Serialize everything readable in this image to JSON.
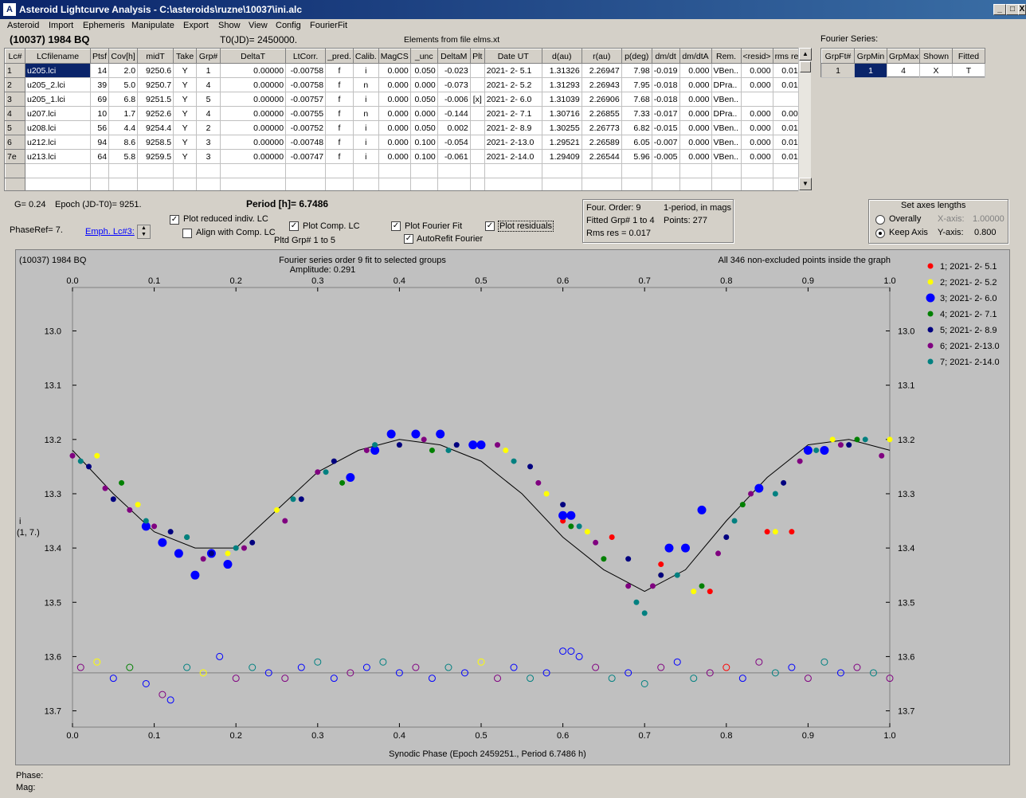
{
  "window": {
    "title": "Asteroid Lightcurve Analysis - C:\\asteroids\\ruzne\\10037\\ini.alc",
    "icon": "app-icon",
    "controls": [
      "_",
      "□",
      "X"
    ]
  },
  "menu": [
    "Asteroid",
    "Import",
    "Ephemeris",
    "Manipulate",
    "Export",
    "Show",
    "View",
    "Config",
    "FourierFit"
  ],
  "header": {
    "asteroid": "(10037) 1984 BQ",
    "t0": "T0(JD)= 2450000.",
    "elements": "Elements from file elms.xt",
    "fourier_series_label": "Fourier Series:"
  },
  "lc_table": {
    "columns": [
      "Lc#",
      "LCfilename",
      "Ptsf",
      "Cov[h]",
      "midT",
      "Take",
      "Grp#",
      "DeltaT",
      "LtCorr.",
      "_pred.",
      "Calib.",
      "MagCS",
      "_unc",
      "DeltaM",
      "Plt",
      "Date UT",
      "d(au)",
      "r(au)",
      "p(deg)",
      "dm/dt",
      "dm/dtA",
      "Rem.",
      "<resid>",
      "rms res"
    ],
    "rows": [
      [
        "1",
        "u205.lci",
        "14",
        "2.0",
        "9250.6",
        "Y",
        "1",
        "0.00000",
        "-0.00758",
        "f",
        "i",
        "0.000",
        "0.050",
        "-0.023",
        "",
        "2021- 2- 5.1",
        "1.31326",
        "2.26947",
        "7.98",
        "-0.019",
        "0.000",
        "VBen..",
        "0.000",
        "0.013"
      ],
      [
        "2",
        "u205_2.lci",
        "39",
        "5.0",
        "9250.7",
        "Y",
        "4",
        "0.00000",
        "-0.00758",
        "f",
        "n",
        "0.000",
        "0.000",
        "-0.073",
        "",
        "2021- 2- 5.2",
        "1.31293",
        "2.26943",
        "7.95",
        "-0.018",
        "0.000",
        "DPra..",
        "0.000",
        "0.015"
      ],
      [
        "3",
        "u205_1.lci",
        "69",
        "6.8",
        "9251.5",
        "Y",
        "5",
        "0.00000",
        "-0.00757",
        "f",
        "i",
        "0.000",
        "0.050",
        "-0.006",
        "[x]",
        "2021- 2- 6.0",
        "1.31039",
        "2.26906",
        "7.68",
        "-0.018",
        "0.000",
        "VBen..",
        "",
        ""
      ],
      [
        "4",
        "u207.lci",
        "10",
        "1.7",
        "9252.6",
        "Y",
        "4",
        "0.00000",
        "-0.00755",
        "f",
        "n",
        "0.000",
        "0.000",
        "-0.144",
        "",
        "2021- 2- 7.1",
        "1.30716",
        "2.26855",
        "7.33",
        "-0.017",
        "0.000",
        "DPra..",
        "0.000",
        "0.009"
      ],
      [
        "5",
        "u208.lci",
        "56",
        "4.4",
        "9254.4",
        "Y",
        "2",
        "0.00000",
        "-0.00752",
        "f",
        "i",
        "0.000",
        "0.050",
        "0.002",
        "",
        "2021- 2- 8.9",
        "1.30255",
        "2.26773",
        "6.82",
        "-0.015",
        "0.000",
        "VBen..",
        "0.000",
        "0.013"
      ],
      [
        "6",
        "u212.lci",
        "94",
        "8.6",
        "9258.5",
        "Y",
        "3",
        "0.00000",
        "-0.00748",
        "f",
        "i",
        "0.000",
        "0.100",
        "-0.054",
        "",
        "2021- 2-13.0",
        "1.29521",
        "2.26589",
        "6.05",
        "-0.007",
        "0.000",
        "VBen..",
        "0.000",
        "0.018"
      ],
      [
        "7e",
        "u213.lci",
        "64",
        "5.8",
        "9259.5",
        "Y",
        "3",
        "0.00000",
        "-0.00747",
        "f",
        "i",
        "0.000",
        "0.100",
        "-0.061",
        "",
        "2021- 2-14.0",
        "1.29409",
        "2.26544",
        "5.96",
        "-0.005",
        "0.000",
        "VBen..",
        "0.000",
        "0.018"
      ]
    ],
    "empty_rows": 2
  },
  "fourier_table": {
    "columns": [
      "GrpFt#",
      "GrpMin",
      "GrpMax",
      "Shown",
      "Fitted"
    ],
    "row": [
      "1",
      "1",
      "4",
      "X",
      "T"
    ]
  },
  "controls": {
    "g": "G= 0.24",
    "epoch": "Epoch (JD-T0)= 9251.",
    "period": "Period [h]= 6.7486",
    "phaseref": "PhaseRef= 7.",
    "emph": "Emph. Lc#3:",
    "plot_reduced": "Plot reduced indiv. LC",
    "align": "Align with Comp. LC",
    "plot_comp": "Plot Comp. LC",
    "pltd_grp": "Pltd Grp#  1   to   5",
    "plot_fourier": "Plot Fourier Fit",
    "autorefit": "AutoRefit Fourier",
    "plot_resid": "Plot residuals",
    "four_order": "Four. Order:  9",
    "one_period": "1-period, in mags",
    "fitted_grp": "Fitted Grp# 1 to 4",
    "points": "Points: 277",
    "rms_res": "Rms res      = 0.017",
    "axes_title": "Set axes lengths",
    "overally": "Overally",
    "keep_axis": "Keep Axis",
    "x_axis_label": "X-axis:",
    "x_axis_val": "1.00000",
    "y_axis_label": "Y-axis:",
    "y_axis_val": "0.800",
    "checks": {
      "plot_reduced": true,
      "align": false,
      "plot_comp": true,
      "plot_fourier": true,
      "autorefit": true,
      "plot_resid": true
    }
  },
  "plot": {
    "top_left": "(10037) 1984 BQ",
    "title1": "Fourier series order 9 fit to selected groups",
    "title2": "Amplitude: 0.291",
    "top_right": "All 346 non-excluded points inside the graph",
    "xlabel": "Synodic Phase (Epoch 2459251., Period 6.7486 h)",
    "ylabel1": "i",
    "ylabel2": "(1, 7.)",
    "phase_label": "Phase:",
    "mag_label": "Mag:"
  },
  "chart_data": {
    "type": "scatter",
    "xlim": [
      0.0,
      1.0
    ],
    "ylim": [
      13.73,
      12.92
    ],
    "y_inverted": true,
    "xticks": [
      0.0,
      0.1,
      0.2,
      0.3,
      0.4,
      0.5,
      0.6,
      0.7,
      0.8,
      0.9,
      1.0
    ],
    "yticks": [
      13.0,
      13.1,
      13.2,
      13.3,
      13.4,
      13.5,
      13.6,
      13.7
    ],
    "grid": false,
    "legend_position": "right",
    "fourier_curve": {
      "x": [
        0.0,
        0.05,
        0.1,
        0.15,
        0.2,
        0.25,
        0.3,
        0.35,
        0.4,
        0.45,
        0.5,
        0.55,
        0.6,
        0.65,
        0.7,
        0.75,
        0.8,
        0.85,
        0.9,
        0.95,
        1.0
      ],
      "y": [
        13.22,
        13.3,
        13.37,
        13.4,
        13.4,
        13.33,
        13.26,
        13.22,
        13.2,
        13.21,
        13.24,
        13.3,
        13.38,
        13.44,
        13.48,
        13.44,
        13.35,
        13.27,
        13.21,
        13.2,
        13.22
      ]
    },
    "residual_baseline": 13.63,
    "series": [
      {
        "name": "1; 2021- 2- 5.1",
        "color": "#ff0000",
        "size": "small",
        "x": [
          0.6,
          0.66,
          0.72,
          0.78,
          0.85,
          0.88
        ],
        "y": [
          13.35,
          13.38,
          13.43,
          13.48,
          13.37,
          13.37
        ]
      },
      {
        "name": "2; 2021- 2- 5.2",
        "color": "#ffff00",
        "size": "small",
        "x": [
          0.03,
          0.08,
          0.19,
          0.25,
          0.53,
          0.58,
          0.63,
          0.72,
          0.76,
          0.86,
          0.93,
          1.0
        ],
        "y": [
          13.23,
          13.32,
          13.41,
          13.33,
          13.22,
          13.3,
          13.37,
          13.45,
          13.48,
          13.37,
          13.2,
          13.2
        ]
      },
      {
        "name": "3; 2021- 2- 6.0",
        "color": "#0000ff",
        "size": "large",
        "x": [
          0.09,
          0.11,
          0.13,
          0.15,
          0.17,
          0.19,
          0.34,
          0.37,
          0.39,
          0.42,
          0.45,
          0.49,
          0.5,
          0.6,
          0.61,
          0.73,
          0.75,
          0.77,
          0.84,
          0.9,
          0.92
        ],
        "y": [
          13.36,
          13.39,
          13.41,
          13.45,
          13.41,
          13.43,
          13.27,
          13.22,
          13.19,
          13.19,
          13.19,
          13.21,
          13.21,
          13.34,
          13.34,
          13.4,
          13.4,
          13.33,
          13.29,
          13.22,
          13.22
        ]
      },
      {
        "name": "4; 2021- 2- 7.1",
        "color": "#008000",
        "size": "small",
        "x": [
          0.06,
          0.14,
          0.33,
          0.44,
          0.61,
          0.65,
          0.77,
          0.82,
          0.96
        ],
        "y": [
          13.28,
          13.38,
          13.28,
          13.22,
          13.36,
          13.42,
          13.47,
          13.32,
          13.2
        ]
      },
      {
        "name": "5; 2021- 2- 8.9",
        "color": "#000080",
        "size": "small",
        "x": [
          0.02,
          0.05,
          0.12,
          0.17,
          0.22,
          0.28,
          0.32,
          0.4,
          0.47,
          0.56,
          0.6,
          0.68,
          0.72,
          0.8,
          0.87,
          0.95
        ],
        "y": [
          13.25,
          13.31,
          13.37,
          13.41,
          13.39,
          13.31,
          13.24,
          13.21,
          13.21,
          13.25,
          13.32,
          13.42,
          13.45,
          13.38,
          13.28,
          13.21
        ]
      },
      {
        "name": "6; 2021- 2-13.0",
        "color": "#800080",
        "size": "small",
        "x": [
          0.0,
          0.04,
          0.07,
          0.1,
          0.16,
          0.21,
          0.26,
          0.3,
          0.36,
          0.43,
          0.52,
          0.57,
          0.64,
          0.68,
          0.71,
          0.79,
          0.83,
          0.89,
          0.94,
          0.99
        ],
        "y": [
          13.23,
          13.29,
          13.33,
          13.36,
          13.42,
          13.4,
          13.35,
          13.26,
          13.22,
          13.2,
          13.21,
          13.28,
          13.39,
          13.47,
          13.47,
          13.41,
          13.3,
          13.24,
          13.21,
          13.23
        ]
      },
      {
        "name": "7; 2021- 2-14.0",
        "color": "#008080",
        "size": "small",
        "x": [
          0.01,
          0.09,
          0.14,
          0.2,
          0.27,
          0.31,
          0.37,
          0.46,
          0.54,
          0.62,
          0.69,
          0.7,
          0.74,
          0.81,
          0.86,
          0.91,
          0.97
        ],
        "y": [
          13.24,
          13.35,
          13.38,
          13.4,
          13.31,
          13.26,
          13.21,
          13.22,
          13.24,
          13.36,
          13.5,
          13.52,
          13.45,
          13.35,
          13.3,
          13.22,
          13.2
        ]
      }
    ],
    "residuals": {
      "x": [
        0.01,
        0.03,
        0.05,
        0.07,
        0.09,
        0.11,
        0.12,
        0.14,
        0.16,
        0.18,
        0.2,
        0.22,
        0.24,
        0.26,
        0.28,
        0.3,
        0.32,
        0.34,
        0.36,
        0.38,
        0.4,
        0.42,
        0.44,
        0.46,
        0.48,
        0.5,
        0.52,
        0.54,
        0.56,
        0.58,
        0.6,
        0.61,
        0.62,
        0.64,
        0.66,
        0.68,
        0.7,
        0.72,
        0.74,
        0.76,
        0.78,
        0.8,
        0.82,
        0.84,
        0.86,
        0.88,
        0.9,
        0.92,
        0.94,
        0.96,
        0.98,
        1.0
      ],
      "y": [
        13.62,
        13.61,
        13.64,
        13.62,
        13.65,
        13.67,
        13.68,
        13.62,
        13.63,
        13.6,
        13.64,
        13.62,
        13.63,
        13.64,
        13.62,
        13.61,
        13.64,
        13.63,
        13.62,
        13.61,
        13.63,
        13.62,
        13.64,
        13.62,
        13.63,
        13.61,
        13.64,
        13.62,
        13.64,
        13.63,
        13.59,
        13.59,
        13.6,
        13.62,
        13.64,
        13.63,
        13.65,
        13.62,
        13.61,
        13.64,
        13.63,
        13.62,
        13.64,
        13.61,
        13.63,
        13.62,
        13.64,
        13.61,
        13.63,
        13.62,
        13.63,
        13.64
      ],
      "colors": [
        "#800080",
        "#ffff00",
        "#0000ff",
        "#008000",
        "#0000ff",
        "#800080",
        "#0000ff",
        "#008080",
        "#ffff00",
        "#0000ff",
        "#800080",
        "#008080",
        "#0000ff",
        "#800080",
        "#0000ff",
        "#008080",
        "#0000ff",
        "#800080",
        "#0000ff",
        "#008080",
        "#0000ff",
        "#800080",
        "#0000ff",
        "#008080",
        "#0000ff",
        "#ffff00",
        "#800080",
        "#0000ff",
        "#008080",
        "#0000ff",
        "#0000ff",
        "#0000ff",
        "#0000ff",
        "#800080",
        "#008080",
        "#0000ff",
        "#008080",
        "#800080",
        "#0000ff",
        "#008080",
        "#800080",
        "#ff0000",
        "#0000ff",
        "#800080",
        "#008080",
        "#0000ff",
        "#800080",
        "#008080",
        "#0000ff",
        "#800080",
        "#008080",
        "#800080"
      ]
    }
  }
}
